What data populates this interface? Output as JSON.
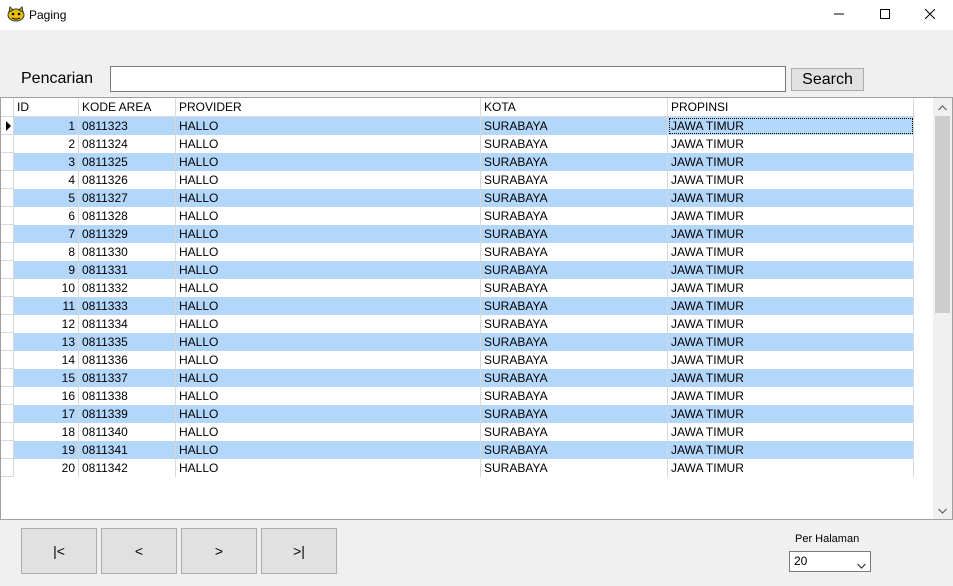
{
  "window": {
    "title": "Paging"
  },
  "search": {
    "label": "Pencarian",
    "value": "",
    "placeholder": "",
    "button_label": "Search"
  },
  "grid": {
    "columns": [
      "ID",
      "KODE AREA",
      "PROVIDER",
      "KOTA",
      "PROPINSI"
    ],
    "rows": [
      [
        "1",
        "0811323",
        "HALLO",
        "SURABAYA",
        "JAWA TIMUR"
      ],
      [
        "2",
        "0811324",
        "HALLO",
        "SURABAYA",
        "JAWA TIMUR"
      ],
      [
        "3",
        "0811325",
        "HALLO",
        "SURABAYA",
        "JAWA TIMUR"
      ],
      [
        "4",
        "0811326",
        "HALLO",
        "SURABAYA",
        "JAWA TIMUR"
      ],
      [
        "5",
        "0811327",
        "HALLO",
        "SURABAYA",
        "JAWA TIMUR"
      ],
      [
        "6",
        "0811328",
        "HALLO",
        "SURABAYA",
        "JAWA TIMUR"
      ],
      [
        "7",
        "0811329",
        "HALLO",
        "SURABAYA",
        "JAWA TIMUR"
      ],
      [
        "8",
        "0811330",
        "HALLO",
        "SURABAYA",
        "JAWA TIMUR"
      ],
      [
        "9",
        "0811331",
        "HALLO",
        "SURABAYA",
        "JAWA TIMUR"
      ],
      [
        "10",
        "0811332",
        "HALLO",
        "SURABAYA",
        "JAWA TIMUR"
      ],
      [
        "11",
        "0811333",
        "HALLO",
        "SURABAYA",
        "JAWA TIMUR"
      ],
      [
        "12",
        "0811334",
        "HALLO",
        "SURABAYA",
        "JAWA TIMUR"
      ],
      [
        "13",
        "0811335",
        "HALLO",
        "SURABAYA",
        "JAWA TIMUR"
      ],
      [
        "14",
        "0811336",
        "HALLO",
        "SURABAYA",
        "JAWA TIMUR"
      ],
      [
        "15",
        "0811337",
        "HALLO",
        "SURABAYA",
        "JAWA TIMUR"
      ],
      [
        "16",
        "0811338",
        "HALLO",
        "SURABAYA",
        "JAWA TIMUR"
      ],
      [
        "17",
        "0811339",
        "HALLO",
        "SURABAYA",
        "JAWA TIMUR"
      ],
      [
        "18",
        "0811340",
        "HALLO",
        "SURABAYA",
        "JAWA TIMUR"
      ],
      [
        "19",
        "0811341",
        "HALLO",
        "SURABAYA",
        "JAWA TIMUR"
      ],
      [
        "20",
        "0811342",
        "HALLO",
        "SURABAYA",
        "JAWA TIMUR"
      ]
    ],
    "alt_row_color": "#b3d7fb"
  },
  "pager": {
    "first_label": "|<",
    "prev_label": "<",
    "next_label": ">",
    "last_label": ">|",
    "per_page_label": "Per Halaman",
    "per_page_value": "20"
  },
  "icons": {
    "app": "app-cat-icon",
    "minimize": "minimize-icon",
    "maximize": "maximize-icon",
    "close": "close-icon",
    "scroll_up": "chevron-up-icon",
    "scroll_down": "chevron-down-icon",
    "select": "chevron-down-icon"
  }
}
